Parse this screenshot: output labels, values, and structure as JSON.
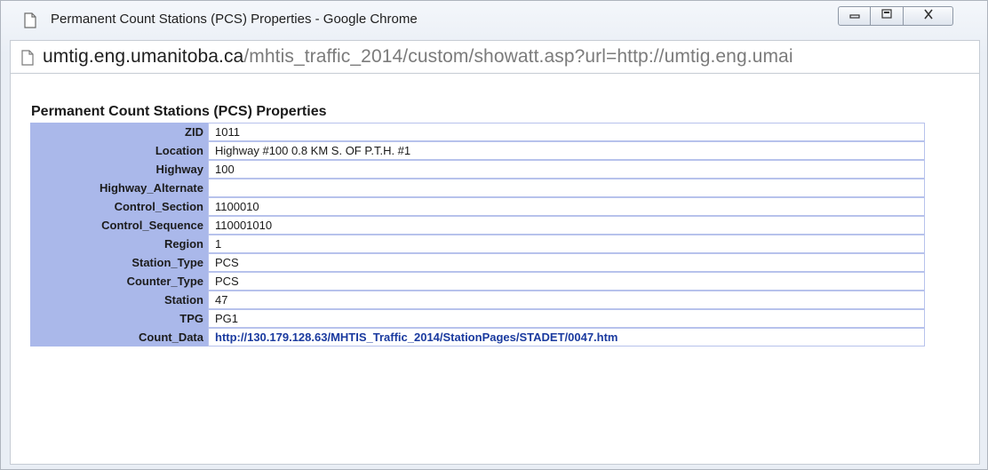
{
  "window": {
    "title": "Permanent Count Stations (PCS) Properties - Google Chrome",
    "controls": {
      "minimize": "minimize-icon",
      "restore": "restore-icon",
      "close": "close-icon"
    }
  },
  "address_bar": {
    "host": "umtig.eng.umanitoba.ca",
    "path": "/mhtis_traffic_2014/custom/showatt.asp?url=http://umtig.eng.umai"
  },
  "page": {
    "title": "Permanent Count Stations (PCS) Properties",
    "properties": [
      {
        "label": "ZID",
        "value": "1011"
      },
      {
        "label": "Location",
        "value": "Highway #100 0.8 KM S. OF P.T.H. #1"
      },
      {
        "label": "Highway",
        "value": "100"
      },
      {
        "label": "Highway_Alternate",
        "value": ""
      },
      {
        "label": "Control_Section",
        "value": "1100010"
      },
      {
        "label": "Control_Sequence",
        "value": "110001010"
      },
      {
        "label": "Region",
        "value": "1"
      },
      {
        "label": "Station_Type",
        "value": "PCS"
      },
      {
        "label": "Counter_Type",
        "value": "PCS"
      },
      {
        "label": "Station",
        "value": "47"
      },
      {
        "label": "TPG",
        "value": "PG1"
      },
      {
        "label": "Count_Data",
        "value": "http://130.179.128.63/MHTIS_Traffic_2014/StationPages/STADET/0047.htm",
        "link": true
      }
    ]
  },
  "colors": {
    "label_bg": "#aab8ea",
    "link": "#1a3a9f"
  }
}
